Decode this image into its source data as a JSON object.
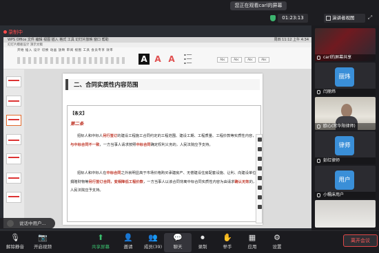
{
  "top": {
    "banner": "您正在观看carl的屏幕",
    "timer": "01:23:13",
    "speaker_view": "演讲者视图"
  },
  "share": {
    "recording_label": "录制中",
    "mac_bar_left": "WPS Office  文件  编辑  视图  插入  格式  工具  幻灯片放映  窗口  帮助",
    "mac_bar_right": "周四 11:12 上午 4:34",
    "wps_tabs": "幻灯片模板设计   演示文稿",
    "ribbon_menu": "开始  插入  设计  切换  动画  放映  审阅  视图  工具  会员专享  效率",
    "ribbon_boxes": [
      "Abc",
      "Abc",
      "Abc",
      "Abc"
    ],
    "slide_title": "二、合同实质性内容范围",
    "label": "【条文】",
    "article": "第二条",
    "para1": [
      {
        "t": "招标人和中标人",
        "h": false
      },
      {
        "t": "另行签订",
        "h": true
      },
      {
        "t": "的建设工程施工合同约定的工程范围、建设工期、工程质量、工程价款等实质性内容，",
        "h": false
      },
      {
        "t": "与中标合同不一致",
        "h": true
      },
      {
        "t": "，一方当事人请求按照",
        "h": false
      },
      {
        "t": "中标合同",
        "h": true
      },
      {
        "t": "确定权利义务的，人民法院应予支持。",
        "h": false
      }
    ],
    "para2": [
      {
        "t": "招标人和中标人在",
        "h": false
      },
      {
        "t": "中标合同",
        "h": true
      },
      {
        "t": "之外就明显高于市场价格购买承建房产、无偿建设住房配套设施、让利、向建设单位捐赠财物等",
        "h": false
      },
      {
        "t": "另行签订合同，变相降低工程价款",
        "h": true
      },
      {
        "t": "，一方当事人以该合同背离中标合同实质性内容为由请求",
        "h": false
      },
      {
        "t": "确认无效",
        "h": true
      },
      {
        "t": "的，人民法院应予支持。",
        "h": false
      }
    ],
    "voice_tip": "说话中用户..."
  },
  "participants": [
    {
      "name": "carl的屏幕共享",
      "kind": "video1"
    },
    {
      "name": "闫丽炜",
      "avatar": "丽炜",
      "color": "#3a8fd8"
    },
    {
      "name": "欧心(常华阳律师)",
      "kind": "video2"
    },
    {
      "name": "彭红律师",
      "avatar": "律师",
      "color": "#3a8fd8"
    },
    {
      "name": "小糯床用户",
      "avatar": "用户",
      "color": "#3a8fd8"
    },
    {
      "name": "",
      "kind": "video3"
    }
  ],
  "toolbar": [
    {
      "label": "解除静音",
      "icon": "mic-muted-icon",
      "glyph": "🎙"
    },
    {
      "label": "开启视频",
      "icon": "camera-off-icon",
      "glyph": "📷"
    },
    {
      "label": "共享屏幕",
      "icon": "share-screen-icon",
      "glyph": "⬆"
    },
    {
      "label": "邀请",
      "icon": "invite-icon",
      "glyph": "👤"
    },
    {
      "label": "成员(39)",
      "icon": "members-icon",
      "glyph": "👥"
    },
    {
      "label": "聊天",
      "icon": "chat-icon",
      "glyph": "💬"
    },
    {
      "label": "录制",
      "icon": "record-icon",
      "glyph": "⏺"
    },
    {
      "label": "举手",
      "icon": "raise-hand-icon",
      "glyph": "✋"
    },
    {
      "label": "应用",
      "icon": "apps-icon",
      "glyph": "▦"
    },
    {
      "label": "设置",
      "icon": "settings-icon",
      "glyph": "⚙"
    }
  ],
  "leave_label": "离开会议",
  "colors": {
    "accent_green": "#3ac06e",
    "leave_red": "#e04848",
    "avatar_blue": "#3a8fd8",
    "highlight_red": "#c0392b"
  }
}
